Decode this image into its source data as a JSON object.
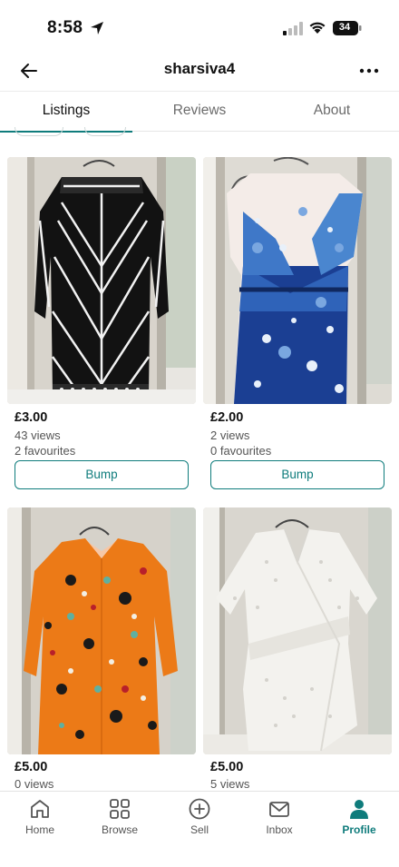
{
  "status_bar": {
    "time": "8:58",
    "battery": "34"
  },
  "header": {
    "title": "sharsiva4"
  },
  "tabs": [
    {
      "label": "Listings",
      "active": true
    },
    {
      "label": "Reviews",
      "active": false
    },
    {
      "label": "About",
      "active": false
    }
  ],
  "listings": [
    {
      "price": "£3.00",
      "views": "43 views",
      "favourites": "2 favourites",
      "bump_label": "Bump",
      "image": "black-white-geometric-dress"
    },
    {
      "price": "£2.00",
      "views": "2 views",
      "favourites": "0 favourites",
      "bump_label": "Bump",
      "image": "blue-floral-dress"
    },
    {
      "price": "£5.00",
      "views": "0 views",
      "image": "orange-floral-shirt-dress"
    },
    {
      "price": "£5.00",
      "views": "5 views",
      "image": "white-lace-wrap-dress"
    }
  ],
  "bottom_nav": [
    {
      "label": "Home",
      "icon": "home-icon",
      "active": false
    },
    {
      "label": "Browse",
      "icon": "grid-icon",
      "active": false
    },
    {
      "label": "Sell",
      "icon": "plus-circle-icon",
      "active": false
    },
    {
      "label": "Inbox",
      "icon": "mail-icon",
      "active": false
    },
    {
      "label": "Profile",
      "icon": "person-icon",
      "active": true
    }
  ],
  "colors": {
    "accent": "#0f7c7c",
    "text_muted": "#555555"
  }
}
